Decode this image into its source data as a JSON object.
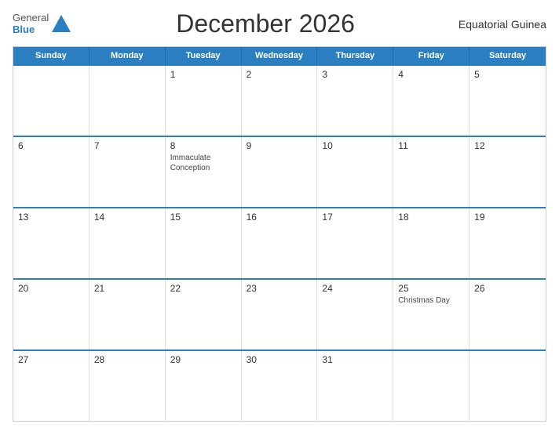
{
  "header": {
    "title": "December 2026",
    "country": "Equatorial Guinea",
    "logo": {
      "general": "General",
      "blue": "Blue"
    }
  },
  "calendar": {
    "days_of_week": [
      "Sunday",
      "Monday",
      "Tuesday",
      "Wednesday",
      "Thursday",
      "Friday",
      "Saturday"
    ],
    "weeks": [
      [
        {
          "day": "",
          "event": ""
        },
        {
          "day": "",
          "event": ""
        },
        {
          "day": "1",
          "event": ""
        },
        {
          "day": "2",
          "event": ""
        },
        {
          "day": "3",
          "event": ""
        },
        {
          "day": "4",
          "event": ""
        },
        {
          "day": "5",
          "event": ""
        }
      ],
      [
        {
          "day": "6",
          "event": ""
        },
        {
          "day": "7",
          "event": ""
        },
        {
          "day": "8",
          "event": "Immaculate\nConception"
        },
        {
          "day": "9",
          "event": ""
        },
        {
          "day": "10",
          "event": ""
        },
        {
          "day": "11",
          "event": ""
        },
        {
          "day": "12",
          "event": ""
        }
      ],
      [
        {
          "day": "13",
          "event": ""
        },
        {
          "day": "14",
          "event": ""
        },
        {
          "day": "15",
          "event": ""
        },
        {
          "day": "16",
          "event": ""
        },
        {
          "day": "17",
          "event": ""
        },
        {
          "day": "18",
          "event": ""
        },
        {
          "day": "19",
          "event": ""
        }
      ],
      [
        {
          "day": "20",
          "event": ""
        },
        {
          "day": "21",
          "event": ""
        },
        {
          "day": "22",
          "event": ""
        },
        {
          "day": "23",
          "event": ""
        },
        {
          "day": "24",
          "event": ""
        },
        {
          "day": "25",
          "event": "Christmas Day"
        },
        {
          "day": "26",
          "event": ""
        }
      ],
      [
        {
          "day": "27",
          "event": ""
        },
        {
          "day": "28",
          "event": ""
        },
        {
          "day": "29",
          "event": ""
        },
        {
          "day": "30",
          "event": ""
        },
        {
          "day": "31",
          "event": ""
        },
        {
          "day": "",
          "event": ""
        },
        {
          "day": "",
          "event": ""
        }
      ]
    ]
  }
}
